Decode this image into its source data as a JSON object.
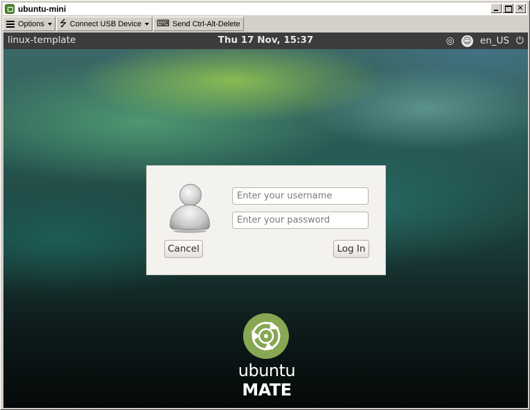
{
  "window": {
    "title": "ubuntu-mini"
  },
  "toolbar": {
    "options_label": "Options",
    "usb_label": "Connect USB Device",
    "cad_label": "Send Ctrl-Alt-Delete"
  },
  "topbar": {
    "hostname": "linux-template",
    "clock": "Thu 17 Nov, 15:37",
    "language": "en_US"
  },
  "login": {
    "username_placeholder": "Enter your username",
    "password_placeholder": "Enter your password",
    "cancel_label": "Cancel",
    "login_label": "Log In"
  },
  "branding": {
    "word1": "ubuntu",
    "word2": "MATE"
  },
  "colors": {
    "mate_green": "#87a752",
    "topbar_bg": "#3c3c3c"
  },
  "icons": {
    "app": "vm-viewer-icon",
    "options": "hamburger-icon",
    "usb": "usb-icon",
    "cad": "keyboard-icon",
    "session": "session-icon",
    "accessibility": "accessibility-icon",
    "power": "power-icon"
  }
}
